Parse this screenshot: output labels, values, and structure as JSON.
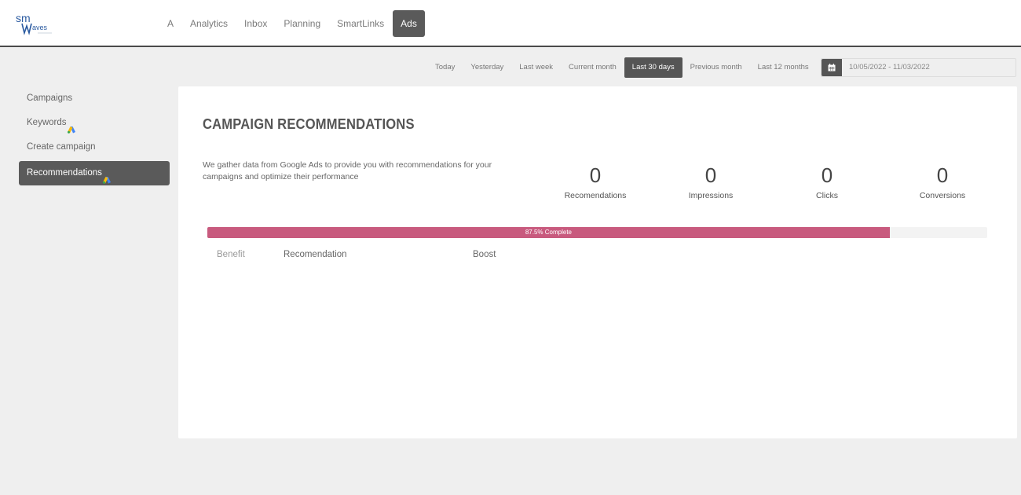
{
  "app": {
    "logo_text_top": "sm",
    "logo_text_bottom": "aves",
    "brand_color": "#2a5aa0"
  },
  "nav": {
    "items": [
      {
        "label": "A",
        "active": false
      },
      {
        "label": "Analytics",
        "active": false
      },
      {
        "label": "Inbox",
        "active": false
      },
      {
        "label": "Planning",
        "active": false
      },
      {
        "label": "SmartLinks",
        "active": false
      },
      {
        "label": "Ads",
        "active": true
      }
    ]
  },
  "date_filter": {
    "ranges": [
      {
        "label": "Today",
        "active": false
      },
      {
        "label": "Yesterday",
        "active": false
      },
      {
        "label": "Last week",
        "active": false
      },
      {
        "label": "Current month",
        "active": false
      },
      {
        "label": "Last 30 days",
        "active": true
      },
      {
        "label": "Previous month",
        "active": false
      },
      {
        "label": "Last 12 months",
        "active": false
      }
    ],
    "date_range": "10/05/2022 - 11/03/2022",
    "icon": "calendar-icon"
  },
  "sidebar": {
    "items": [
      {
        "label": "Campaigns",
        "google_ads_icon": false,
        "active": false
      },
      {
        "label": "Keywords",
        "google_ads_icon": true,
        "active": false
      },
      {
        "label": "Create campaign",
        "google_ads_icon": false,
        "active": false
      },
      {
        "label": "Recommendations",
        "google_ads_icon": true,
        "active": true
      }
    ]
  },
  "main": {
    "title": "CAMPAIGN RECOMMENDATIONS",
    "description": "We gather data from Google Ads to provide you with recommendations for your campaigns and optimize their performance",
    "stats": [
      {
        "value": "0",
        "label": "Recomendations"
      },
      {
        "value": "0",
        "label": "Impressions"
      },
      {
        "value": "0",
        "label": "Clicks"
      },
      {
        "value": "0",
        "label": "Conversions"
      }
    ],
    "progress": {
      "percent": 87.5,
      "label": "87.5% Complete",
      "color": "#c85a7e"
    },
    "table_headers": [
      "Benefit",
      "Recomendation",
      "Boost"
    ]
  }
}
